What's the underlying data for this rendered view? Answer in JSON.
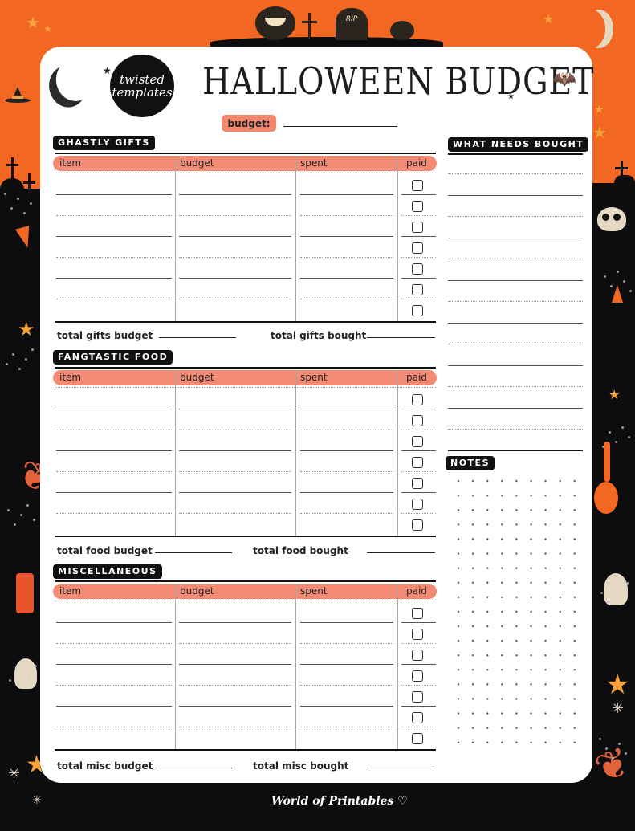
{
  "page": {
    "title": "HALLOWEEN BUDGET",
    "logo": {
      "line1": "twisted",
      "line2": "templates"
    },
    "budget_label": "budget:",
    "footer_brand": "World of Printables ♡"
  },
  "sections": {
    "gifts": {
      "label": "GHASTLY GIFTS",
      "columns": [
        "item",
        "budget",
        "spent",
        "paid"
      ],
      "rows": 7,
      "total_budget_label": "total gifts budget",
      "total_bought_label": "total gifts bought"
    },
    "food": {
      "label": "FANGTASTIC FOOD",
      "columns": [
        "item",
        "budget",
        "spent",
        "paid"
      ],
      "rows": 7,
      "total_budget_label": "total food budget",
      "total_bought_label": "total food bought"
    },
    "misc": {
      "label": "MISCELLANEOUS",
      "columns": [
        "item",
        "budget",
        "spent",
        "paid"
      ],
      "rows": 7,
      "total_budget_label": "total misc budget",
      "total_bought_label": "total misc bought"
    }
  },
  "sidebar": {
    "needs_label": "WHAT NEEDS BOUGHT",
    "notes_label": "NOTES"
  },
  "decorations": {
    "icons": [
      "jack-o-lantern",
      "tombstone-rip",
      "grave-cross",
      "crescent-moon",
      "bat",
      "witch-hat",
      "candy-corn",
      "skull",
      "potion-bottle",
      "ghost",
      "star",
      "leaf-branch"
    ],
    "tombstone_text": "RIP"
  },
  "colors": {
    "orange": "#f26722",
    "header_pink": "#f28a74",
    "background_dark": "#0d0d0f",
    "star_yellow": "#f7a23b"
  }
}
